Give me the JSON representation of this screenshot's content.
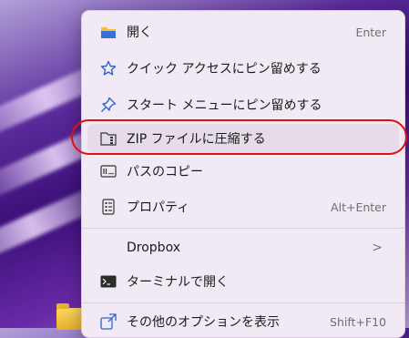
{
  "menu": {
    "items": [
      {
        "label": "開く",
        "shortcut": "Enter",
        "icon": "folder-open-icon"
      },
      {
        "label": "クイック アクセスにピン留めする",
        "shortcut": "",
        "icon": "star-icon"
      },
      {
        "label": "スタート メニューにピン留めする",
        "shortcut": "",
        "icon": "pin-icon"
      },
      {
        "label": "ZIP ファイルに圧縮する",
        "shortcut": "",
        "icon": "zip-archive-icon"
      },
      {
        "label": "パスのコピー",
        "shortcut": "",
        "icon": "copy-path-icon"
      },
      {
        "label": "プロパティ",
        "shortcut": "Alt+Enter",
        "icon": "properties-icon"
      },
      {
        "label": "Dropbox",
        "shortcut": "",
        "icon": "",
        "submenu_arrow": ">"
      },
      {
        "label": "ターミナルで開く",
        "shortcut": "",
        "icon": "terminal-icon"
      },
      {
        "label": "その他のオプションを表示",
        "shortcut": "Shift+F10",
        "icon": "more-options-icon"
      }
    ]
  },
  "colors": {
    "accent": "#3a6fd8",
    "highlight_outline": "#e01010",
    "menu_background": "#f1e9f3"
  }
}
